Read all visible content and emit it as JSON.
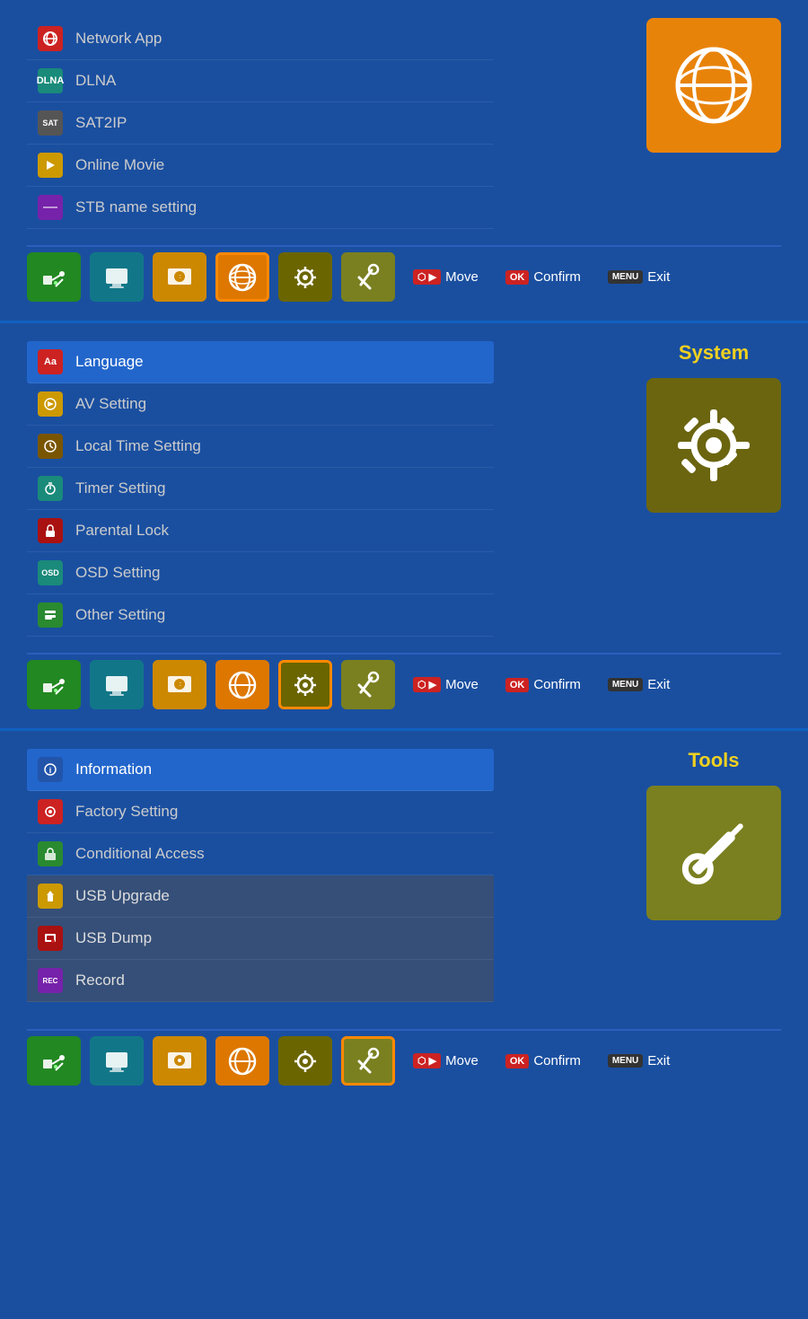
{
  "sections": [
    {
      "id": "network",
      "title": null,
      "icon_color": "orange",
      "icon_type": "globe",
      "items": [
        {
          "label": "Network App",
          "icon_color": "red",
          "icon_char": "📡",
          "active": false,
          "highlighted": false
        },
        {
          "label": "DLNA",
          "icon_color": "teal",
          "icon_char": "D",
          "active": false,
          "highlighted": false
        },
        {
          "label": "SAT2IP",
          "icon_color": "gray",
          "icon_char": "S",
          "active": false,
          "highlighted": false
        },
        {
          "label": "Online Movie",
          "icon_color": "yellow",
          "icon_char": "▶",
          "active": false,
          "highlighted": false
        },
        {
          "label": "STB name setting",
          "icon_color": "purple",
          "icon_char": "—",
          "active": false,
          "highlighted": false
        }
      ],
      "nav": {
        "move_label": "Move",
        "ok_label": "OK",
        "confirm_label": "Confirm",
        "menu_label": "MENU",
        "exit_label": "Exit"
      }
    },
    {
      "id": "system",
      "title": "System",
      "icon_color": "olive",
      "icon_type": "gear",
      "items": [
        {
          "label": "Language",
          "icon_color": "red",
          "icon_char": "Aa",
          "active": true,
          "highlighted": false
        },
        {
          "label": "AV Setting",
          "icon_color": "yellow",
          "icon_char": "🔊",
          "active": false,
          "highlighted": false
        },
        {
          "label": "Local Time Setting",
          "icon_color": "brown",
          "icon_char": "⏰",
          "active": false,
          "highlighted": false
        },
        {
          "label": "Timer Setting",
          "icon_color": "teal",
          "icon_char": "⏱",
          "active": false,
          "highlighted": false
        },
        {
          "label": "Parental Lock",
          "icon_color": "darkred",
          "icon_char": "🔒",
          "active": false,
          "highlighted": false
        },
        {
          "label": "OSD Setting",
          "icon_color": "teal",
          "icon_char": "OSD",
          "active": false,
          "highlighted": false
        },
        {
          "label": "Other Setting",
          "icon_color": "green",
          "icon_char": "⚙",
          "active": false,
          "highlighted": false
        }
      ],
      "nav": {
        "move_label": "Move",
        "ok_label": "OK",
        "confirm_label": "Confirm",
        "menu_label": "MENU",
        "exit_label": "Exit"
      }
    },
    {
      "id": "tools",
      "title": "Tools",
      "icon_color": "tools",
      "icon_type": "tools",
      "items": [
        {
          "label": "Information",
          "icon_color": "blue",
          "icon_char": "ℹ",
          "active": true,
          "highlighted": false
        },
        {
          "label": "Factory Setting",
          "icon_color": "red",
          "icon_char": "⚙",
          "active": false,
          "highlighted": false
        },
        {
          "label": "Conditional Access",
          "icon_color": "green",
          "icon_char": "🔑",
          "active": false,
          "highlighted": false
        },
        {
          "label": "USB Upgrade",
          "icon_color": "yellow",
          "icon_char": "⬆",
          "active": false,
          "highlighted": true
        },
        {
          "label": "USB Dump",
          "icon_color": "darkred",
          "icon_char": "💾",
          "active": false,
          "highlighted": true
        },
        {
          "label": "Record",
          "icon_color": "rec",
          "icon_char": "REC",
          "active": false,
          "highlighted": true
        }
      ],
      "nav": {
        "move_label": "Move",
        "ok_label": "OK",
        "confirm_label": "Confirm",
        "menu_label": "MENU",
        "exit_label": "Exit"
      }
    }
  ]
}
